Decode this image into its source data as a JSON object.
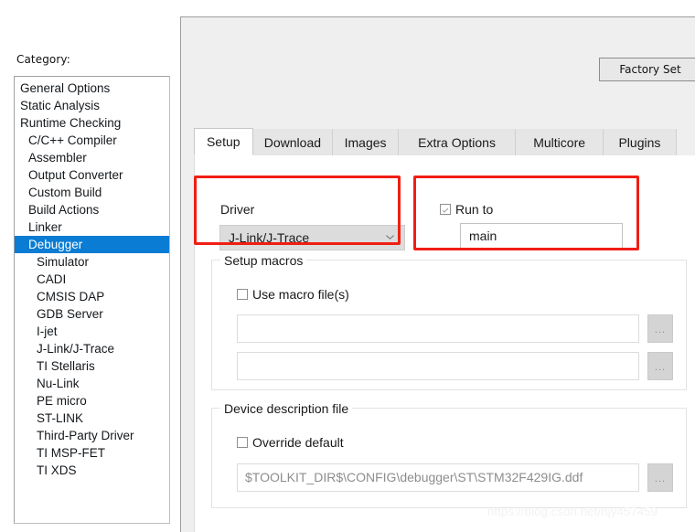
{
  "sidebar": {
    "label": "Category:",
    "items": [
      {
        "label": "General Options",
        "indent": 0,
        "selected": false
      },
      {
        "label": "Static Analysis",
        "indent": 0,
        "selected": false
      },
      {
        "label": "Runtime Checking",
        "indent": 0,
        "selected": false
      },
      {
        "label": "C/C++ Compiler",
        "indent": 1,
        "selected": false
      },
      {
        "label": "Assembler",
        "indent": 1,
        "selected": false
      },
      {
        "label": "Output Converter",
        "indent": 1,
        "selected": false
      },
      {
        "label": "Custom Build",
        "indent": 1,
        "selected": false
      },
      {
        "label": "Build Actions",
        "indent": 1,
        "selected": false
      },
      {
        "label": "Linker",
        "indent": 1,
        "selected": false
      },
      {
        "label": "Debugger",
        "indent": 1,
        "selected": true
      },
      {
        "label": "Simulator",
        "indent": 2,
        "selected": false
      },
      {
        "label": "CADI",
        "indent": 2,
        "selected": false
      },
      {
        "label": "CMSIS DAP",
        "indent": 2,
        "selected": false
      },
      {
        "label": "GDB Server",
        "indent": 2,
        "selected": false
      },
      {
        "label": "I-jet",
        "indent": 2,
        "selected": false
      },
      {
        "label": "J-Link/J-Trace",
        "indent": 2,
        "selected": false
      },
      {
        "label": "TI Stellaris",
        "indent": 2,
        "selected": false
      },
      {
        "label": "Nu-Link",
        "indent": 2,
        "selected": false
      },
      {
        "label": "PE micro",
        "indent": 2,
        "selected": false
      },
      {
        "label": "ST-LINK",
        "indent": 2,
        "selected": false
      },
      {
        "label": "Third-Party Driver",
        "indent": 2,
        "selected": false
      },
      {
        "label": "TI MSP-FET",
        "indent": 2,
        "selected": false
      },
      {
        "label": "TI XDS",
        "indent": 2,
        "selected": false
      }
    ]
  },
  "toolbar": {
    "factory_settings_label": "Factory Set"
  },
  "tabs": [
    {
      "label": "Setup",
      "active": true
    },
    {
      "label": "Download",
      "active": false
    },
    {
      "label": "Images",
      "active": false
    },
    {
      "label": "Extra Options",
      "active": false
    },
    {
      "label": "Multicore",
      "active": false
    },
    {
      "label": "Plugins",
      "active": false
    }
  ],
  "setup": {
    "driver": {
      "label": "Driver",
      "selected_value": "J-Link/J-Trace",
      "caret_icon": "chevron-down-icon"
    },
    "run_to": {
      "label": "Run to",
      "checked": true,
      "value": "main"
    },
    "setup_macros": {
      "title": "Setup macros",
      "use_macro_files": {
        "label": "Use macro file(s)",
        "checked": false
      },
      "file_1": "",
      "file_2": "",
      "browse_label": "..."
    },
    "device_description": {
      "title": "Device description file",
      "override_default": {
        "label": "Override default",
        "checked": false
      },
      "path": "$TOOLKIT_DIR$\\CONFIG\\debugger\\ST\\STM32F429IG.ddf",
      "browse_label": "..."
    }
  },
  "watermark": {
    "text": "https://blog.csdn.net/hjy457459"
  },
  "colors": {
    "selection_blue": "#0a7cd4",
    "highlight_red": "#f01e14",
    "panel_bg": "#efefef"
  }
}
